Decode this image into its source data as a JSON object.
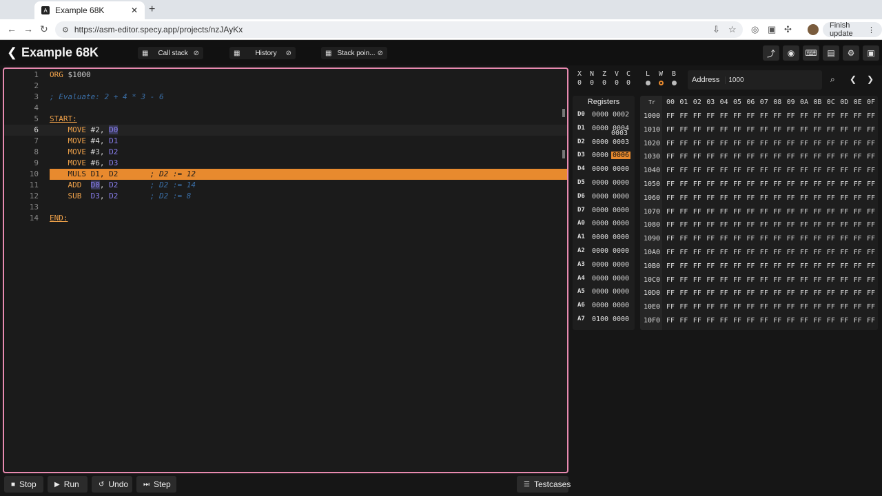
{
  "browser": {
    "tab_title": "Example 68K",
    "url": "https://asm-editor.specy.app/projects/nzJAyKx",
    "finish_update": "Finish update"
  },
  "app": {
    "title": "Example 68K",
    "panels": [
      {
        "label": "Call stack"
      },
      {
        "label": "History"
      },
      {
        "label": "Stack poin..."
      }
    ]
  },
  "editor": {
    "lines": [
      {
        "n": "1",
        "html": "<span class='kw'>ORG</span> <span class='num'>$1000</span>"
      },
      {
        "n": "2",
        "html": ""
      },
      {
        "n": "3",
        "html": "<span class='cm'>; Evaluate: 2 + 4 * 3 - 6</span>"
      },
      {
        "n": "4",
        "html": ""
      },
      {
        "n": "5",
        "html": "<span class='lbl'>START:</span>"
      },
      {
        "n": "6",
        "html": "    <span class='kw'>MOVE</span> <span class='num'>#2,</span> <span class='regsel'>D0</span>"
      },
      {
        "n": "7",
        "html": "    <span class='kw'>MOVE</span> <span class='num'>#4,</span> <span class='reg'>D1</span>"
      },
      {
        "n": "8",
        "html": "    <span class='kw'>MOVE</span> <span class='num'>#3,</span> <span class='reg'>D2</span>"
      },
      {
        "n": "9",
        "html": "    <span class='kw'>MOVE</span> <span class='num'>#6,</span> <span class='reg'>D3</span>"
      },
      {
        "n": "10",
        "html": "    <span class='kw'>MULS</span> <span class='num'>D1,</span> <span class='reg'>D2</span>       <span class='cm'>; D2 := 12</span>"
      },
      {
        "n": "11",
        "html": "    <span class='kw'>ADD</span>  <span class='regsel'>D0</span><span class='num'>,</span> <span class='reg'>D2</span>       <span class='cm'>; D2 := 14</span>"
      },
      {
        "n": "12",
        "html": "    <span class='kw'>SUB</span>  <span class='reg'>D3</span><span class='num'>,</span> <span class='reg'>D2</span>       <span class='cm'>; D2 := 8</span>"
      },
      {
        "n": "13",
        "html": ""
      },
      {
        "n": "14",
        "html": "<span class='lbl'>END:</span>"
      }
    ],
    "current_line": 6,
    "highlight_line": 10
  },
  "controls": {
    "stop": "Stop",
    "run": "Run",
    "undo": "Undo",
    "step": "Step",
    "testcases": "Testcases"
  },
  "flags": [
    {
      "name": "X",
      "value": "0"
    },
    {
      "name": "N",
      "value": "0"
    },
    {
      "name": "Z",
      "value": "0"
    },
    {
      "name": "V",
      "value": "0"
    },
    {
      "name": "C",
      "value": "0"
    }
  ],
  "sizes": [
    {
      "name": "L"
    },
    {
      "name": "W"
    },
    {
      "name": "B"
    }
  ],
  "address": {
    "label": "Address",
    "value": "1000"
  },
  "registers": {
    "header": "Registers",
    "rows": [
      {
        "name": "D0",
        "hi": "0000",
        "lo": "0002"
      },
      {
        "name": "D1",
        "hi": "0000",
        "lo": "0004"
      },
      {
        "name": "D2",
        "hi": "0000",
        "lo": "0003"
      },
      {
        "name": "D3",
        "hi": "0000",
        "lo": "0006"
      },
      {
        "name": "D4",
        "hi": "0000",
        "lo": "0000"
      },
      {
        "name": "D5",
        "hi": "0000",
        "lo": "0000"
      },
      {
        "name": "D6",
        "hi": "0000",
        "lo": "0000"
      },
      {
        "name": "D7",
        "hi": "0000",
        "lo": "0000"
      },
      {
        "name": "A0",
        "hi": "0000",
        "lo": "0000"
      },
      {
        "name": "A1",
        "hi": "0000",
        "lo": "0000"
      },
      {
        "name": "A2",
        "hi": "0000",
        "lo": "0000"
      },
      {
        "name": "A3",
        "hi": "0000",
        "lo": "0000"
      },
      {
        "name": "A4",
        "hi": "0000",
        "lo": "0000"
      },
      {
        "name": "A5",
        "hi": "0000",
        "lo": "0000"
      },
      {
        "name": "A6",
        "hi": "0000",
        "lo": "0000"
      },
      {
        "name": "A7",
        "hi": "0100",
        "lo": "0000"
      }
    ],
    "tooltip": "0003"
  },
  "memory": {
    "format_label": "Tr",
    "columns": [
      "00",
      "01",
      "02",
      "03",
      "04",
      "05",
      "06",
      "07",
      "08",
      "09",
      "0A",
      "0B",
      "0C",
      "0D",
      "0E",
      "0F"
    ],
    "rows": [
      "1000",
      "1010",
      "1020",
      "1030",
      "1040",
      "1050",
      "1060",
      "1070",
      "1080",
      "1090",
      "10A0",
      "10B0",
      "10C0",
      "10D0",
      "10E0",
      "10F0"
    ],
    "cell_value": "FF"
  }
}
